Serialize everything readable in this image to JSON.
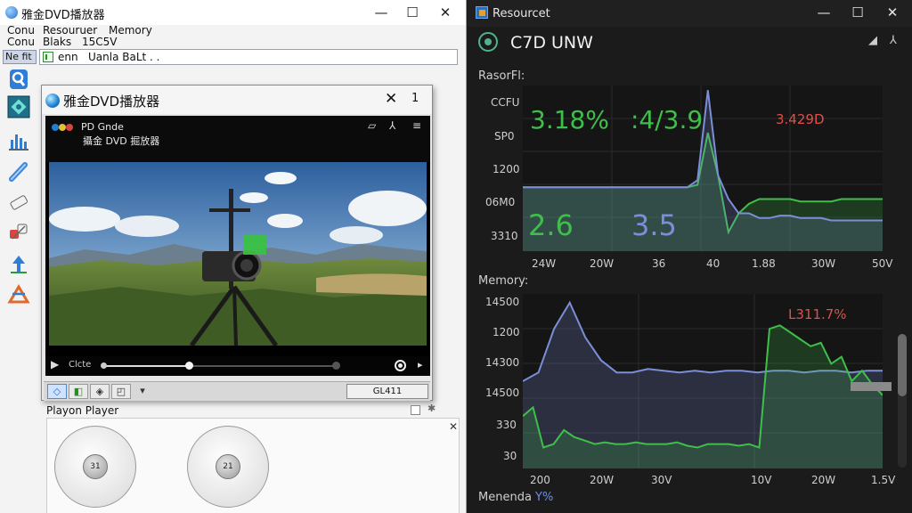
{
  "left_window": {
    "title": "雅金DVD播放器",
    "menu_row1": [
      "Conu",
      "Resouruer",
      "Memory"
    ],
    "menu_row2": [
      "Conu",
      "Blaks",
      "15C5V"
    ],
    "tool_label": "Ne fit",
    "path_text1": "enn",
    "path_text2": "Uanla BaLt . .",
    "controls": {
      "minimize": "—",
      "maximize": "☐",
      "close": "✕"
    }
  },
  "toolbar_icons": [
    "search-icon",
    "target-icon",
    "chart-icon",
    "pen-icon",
    "eraser-icon",
    "tools-icon",
    "pin-icon",
    "share-icon"
  ],
  "dvd_player": {
    "title": "雅金DVD播放器",
    "close": "✕",
    "one": "1",
    "header_line1": "PD Gnde",
    "header_line2": "攝金 DVD 掘放器",
    "header_icons": [
      "▱",
      "⅄",
      "≡"
    ],
    "play_symbol": "▶",
    "time_label": "Clcte",
    "progress": 0.37,
    "right_symbol": "▸",
    "toolbar_buttons": [
      "◇",
      "◧",
      "◈",
      "◰",
      "▾"
    ],
    "button_label": "GL411"
  },
  "lower_panel": {
    "label": "Playon Player",
    "star": "✱",
    "close": "✕",
    "knob_left": "31",
    "knob_right": "21"
  },
  "resource_monitor": {
    "title": "Resourcet",
    "header": "C7D UNW",
    "controls": {
      "minimize": "—",
      "maximize": "☐",
      "close": "✕"
    },
    "header_right": [
      "◢",
      "⅄"
    ],
    "cpu_section": "RasorFl:",
    "mem_section": "Memory:",
    "bottom_label": "Menenda ",
    "bottom_pct": "Y%",
    "cpu_values": {
      "v1": "3.18%",
      "v2": ":4/3.9",
      "v3": "3.429D",
      "v4": "2.6",
      "v5": "3.5"
    },
    "mem_value": "L311.7%",
    "colors": {
      "green": "#3fbf4a",
      "blue": "#7b8fd8",
      "red": "#e0504a"
    }
  },
  "chart_data": [
    {
      "type": "line",
      "title": "RasorFl:",
      "y_tick_labels": [
        "CCFU",
        "SP0",
        "1200",
        "06M0",
        "3310"
      ],
      "x_tick_labels": [
        "24W",
        "20W",
        "36",
        "40",
        "1.88",
        "30W",
        "50V"
      ],
      "series": [
        {
          "color": "#3fbf4a",
          "values": [
            57,
            57,
            57,
            57,
            57,
            57,
            57,
            57,
            57,
            57,
            57,
            57,
            57,
            57,
            57,
            57,
            57,
            58,
            80,
            62,
            38,
            46,
            50,
            52,
            52,
            52,
            52,
            51,
            51,
            51,
            51,
            52,
            52,
            52,
            52,
            52
          ]
        },
        {
          "color": "#7b8fd8",
          "values": [
            57,
            57,
            57,
            57,
            57,
            57,
            57,
            57,
            57,
            57,
            57,
            57,
            57,
            57,
            57,
            57,
            57,
            60,
            98,
            62,
            52,
            46,
            46,
            44,
            44,
            45,
            45,
            44,
            44,
            44,
            43,
            43,
            43,
            43,
            43,
            43
          ]
        }
      ],
      "ylim": [
        30,
        100
      ]
    },
    {
      "type": "area",
      "title": "Memory:",
      "y_tick_labels": [
        "14500",
        "1200",
        "14300",
        "14500",
        "330",
        "30"
      ],
      "x_tick_labels": [
        "200",
        "20W",
        "30V",
        "10V",
        "20W",
        "1.5V"
      ],
      "series": [
        {
          "color": "#7b8fd8",
          "values": [
            50,
            55,
            80,
            95,
            75,
            62,
            55,
            55,
            57,
            56,
            55,
            56,
            55,
            56,
            56,
            55,
            56,
            56,
            55,
            56,
            56,
            55,
            56,
            56
          ]
        },
        {
          "color": "#3fbf4a",
          "values": [
            30,
            35,
            12,
            14,
            22,
            18,
            16,
            14,
            15,
            14,
            14,
            15,
            14,
            14,
            14,
            15,
            13,
            12,
            14,
            14,
            14,
            13,
            14,
            12,
            80,
            82,
            78,
            74,
            70,
            72,
            60,
            64,
            50,
            56,
            48,
            42
          ]
        }
      ],
      "ylim": [
        0,
        100
      ]
    }
  ]
}
